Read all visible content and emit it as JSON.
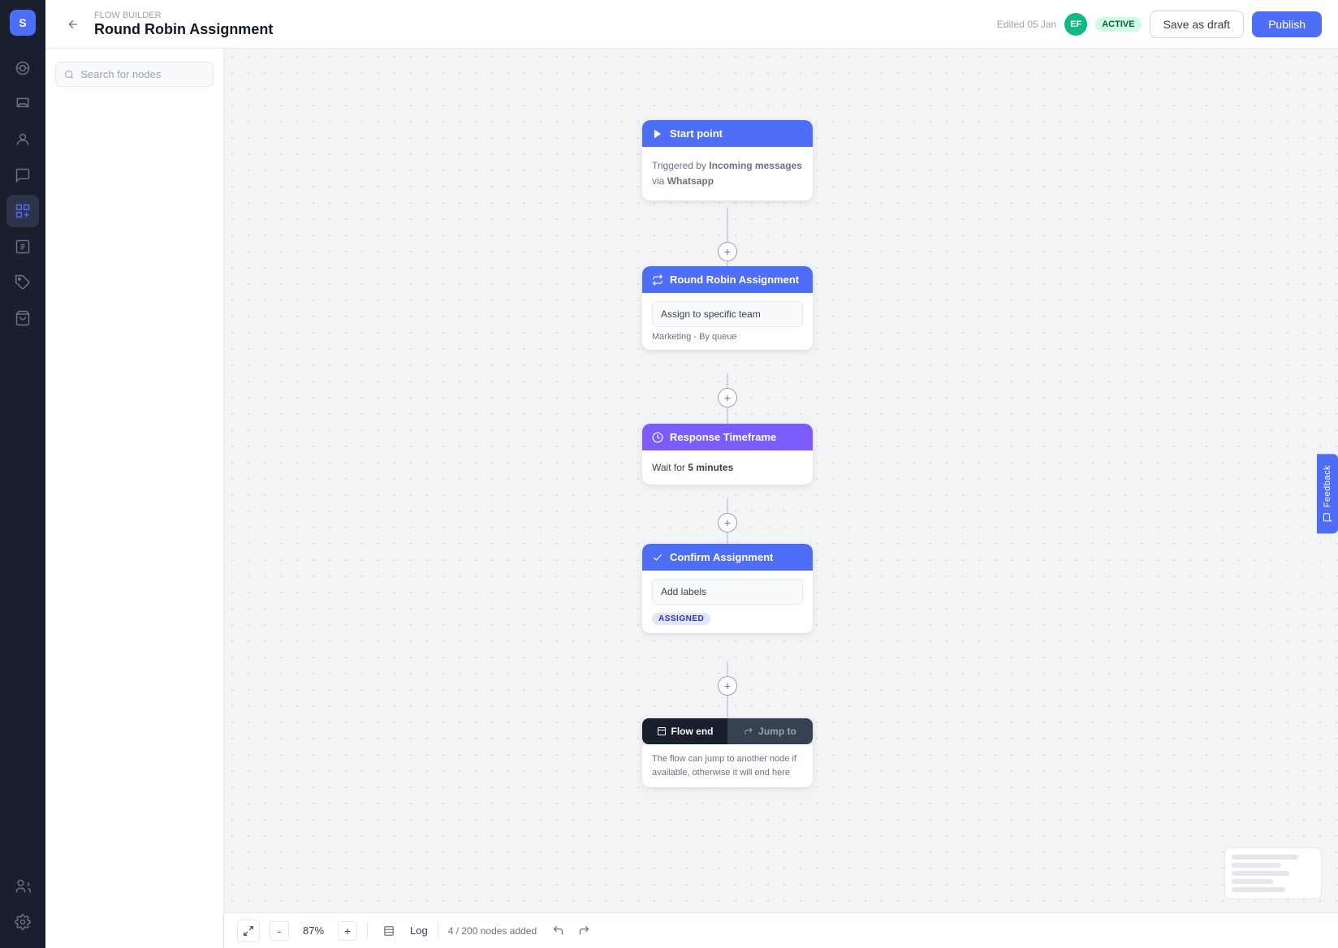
{
  "app": {
    "logo": "S",
    "breadcrumb": "FLOW BUILDER",
    "title": "Round Robin Assignment",
    "edited": "Edited 05 Jan",
    "avatar_initials": "EF",
    "status_badge": "ACTIVE",
    "save_draft_label": "Save as draft",
    "publish_label": "Publish"
  },
  "sidebar": {
    "items": [
      {
        "id": "radio",
        "icon": "radio"
      },
      {
        "id": "inbox",
        "icon": "inbox"
      },
      {
        "id": "contacts",
        "icon": "contacts"
      },
      {
        "id": "chat",
        "icon": "chat"
      },
      {
        "id": "flows",
        "icon": "flows",
        "active": true
      },
      {
        "id": "reports",
        "icon": "reports"
      },
      {
        "id": "labels",
        "icon": "labels"
      },
      {
        "id": "shop",
        "icon": "shop"
      }
    ],
    "bottom": [
      {
        "id": "team",
        "icon": "team"
      },
      {
        "id": "settings",
        "icon": "settings"
      }
    ]
  },
  "search": {
    "placeholder": "Search for nodes"
  },
  "nodes": {
    "start_point": {
      "title": "Start point",
      "trigger_text": "Triggered by",
      "trigger_bold": "Incoming messages",
      "trigger_via": "via",
      "trigger_channel": "Whatsapp"
    },
    "round_robin": {
      "title": "Round Robin Assignment",
      "action": "Assign to specific team",
      "detail": "Marketing - By queue"
    },
    "response_timeframe": {
      "title": "Response Timeframe",
      "text": "Wait for",
      "duration": "5 minutes"
    },
    "confirm_assignment": {
      "title": "Confirm Assignment",
      "action": "Add labels",
      "tag": "ASSIGNED"
    },
    "flow_end": {
      "tab1": "Flow end",
      "tab2": "Jump to",
      "body_text": "The flow can jump to another node if available, otherwise it will end here"
    }
  },
  "bottom_bar": {
    "zoom_out": "-",
    "zoom_level": "87%",
    "zoom_in": "+",
    "log_label": "Log",
    "node_count": "4 / 200 nodes added"
  },
  "colors": {
    "blue": "#4f6ef7",
    "purple": "#7c5cfc",
    "dark": "#1a1f2e",
    "active_green": "#10b981"
  }
}
